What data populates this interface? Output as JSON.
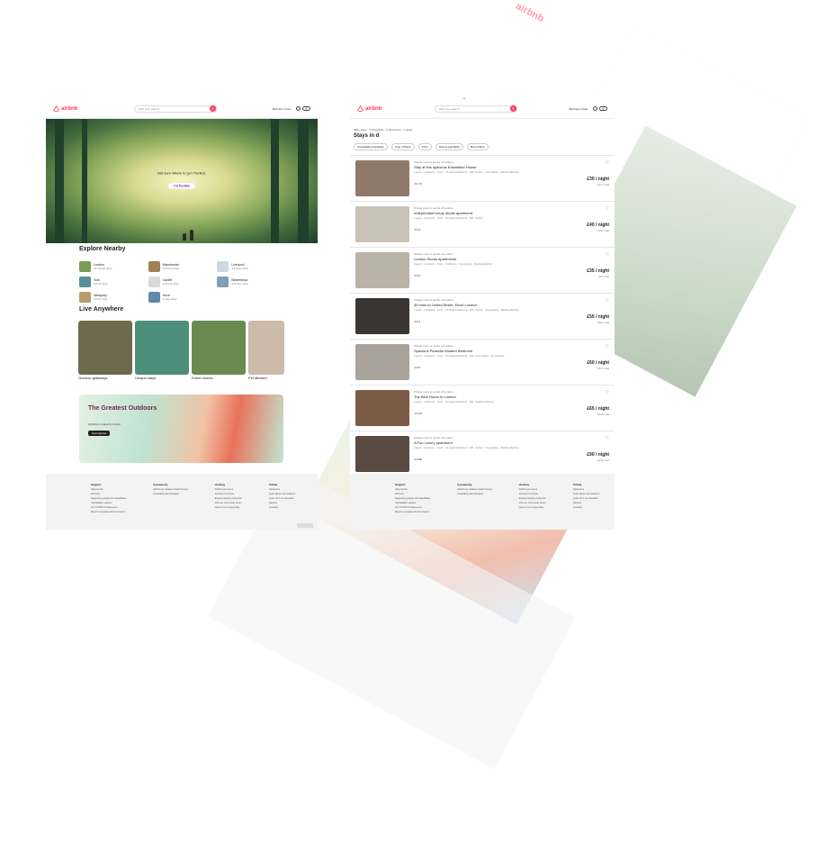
{
  "brand": {
    "name": "airbnb",
    "color": "#ff385c"
  },
  "home": {
    "search_placeholder": "Start your search",
    "host_label": "Become a host",
    "hero_text": "Not sure where to go? Perfect.",
    "hero_button": "I'm flexible",
    "explore_title": "Explore Nearby",
    "nearby": [
      {
        "name": "London",
        "drive": "15 minute drive",
        "color": "#7a9a57"
      },
      {
        "name": "Manchester",
        "drive": "4.5 hour drive",
        "color": "#a18159"
      },
      {
        "name": "Liverpool",
        "drive": "4.5 hour drive",
        "color": "#cfd7e3"
      },
      {
        "name": "York",
        "drive": "4 hour drive",
        "color": "#5b8e9c"
      },
      {
        "name": "Cardiff",
        "drive": "2.5 hour drive",
        "color": "#d9d9d9"
      },
      {
        "name": "Birkenhead",
        "drive": "4.5 hour drive",
        "color": "#7fa0b6"
      },
      {
        "name": "Newquay",
        "drive": "6 hour drive",
        "color": "#b89b6e"
      },
      {
        "name": "Hove",
        "drive": "2 hour drive",
        "color": "#5f8aa8"
      }
    ],
    "live_title": "Live Anywhere",
    "live": [
      {
        "label": "Outdoor getaways",
        "color": "#6f6a4d"
      },
      {
        "label": "Unique stays",
        "color": "#4d8f7b"
      },
      {
        "label": "Entire homes",
        "color": "#6a8a50"
      },
      {
        "label": "Pet allowed",
        "color": "#cbbba8"
      }
    ],
    "promo": {
      "title": "The Greatest Outdoors",
      "subtitle": "Wishlists curated by Airbnb",
      "button": "Get inspired"
    },
    "footer": [
      {
        "heading": "Support",
        "links": [
          "Help Centre",
          "AirCover",
          "Supporting people with disabilities",
          "Cancellation options",
          "Our COVID-19 Response",
          "Report a neighbourhood concern"
        ]
      },
      {
        "heading": "Community",
        "links": [
          "Airbnb.org: disaster relief housing",
          "Combating discrimination"
        ]
      },
      {
        "heading": "Hosting",
        "links": [
          "Airbnb your home",
          "AirCover for Hosts",
          "Explore hosting resources",
          "Visit our community forum",
          "How to host responsibly"
        ]
      },
      {
        "heading": "Airbnb",
        "links": [
          "Newsroom",
          "Learn about new features",
          "Letter from our founders",
          "Careers",
          "Investors"
        ]
      }
    ]
  },
  "listing": {
    "search_placeholder": "Start your search",
    "host_label": "Become a host",
    "breadcrumb": "300+ stays · 5 November - 6 November · 1 guest",
    "title": "Stays in d",
    "filters": [
      "Cancellation Flexibility",
      "Type of Place",
      "Price",
      "Rooms and Beds",
      "More Filters"
    ],
    "rows": [
      {
        "category": "Private room in centre of London",
        "title": "Stay at this spacious Edwardian House",
        "amenities": "1 guest · 1 bedroom · 1 bed · 1.5 shared bathrooms · Wifi · Kitchen · Free parking · Washing Machine",
        "rating": "4.73",
        "price": "£30 / night",
        "total": "£117 total",
        "color": "#8f7a6a"
      },
      {
        "category": "Private room in centre of London",
        "title": "Independant luxury studio apartment",
        "amenities": "2 guest · 1 bedroom · 1 bed · 1.5 shared bathrooms · Wifi · Kitchen",
        "rating": "4.3",
        "price": "£40 / night",
        "total": "£157 total",
        "color": "#c9c2b9"
      },
      {
        "category": "Private room in centre of London",
        "title": "London Studio Apartments",
        "amenities": "4 guest · 1 bedroom · 1 bed · 1 bathroom · Free parking · Washing Machine",
        "rating": "4.6",
        "price": "£35 / night",
        "total": "£27 total",
        "color": "#b9b2a6"
      },
      {
        "category": "Private room in centre of London",
        "title": "30 mins to Oxford Street, Excel London",
        "amenities": "1 guest · 1 bedroom · 1 bed · 1.5 shared bathrooms · Wifi · Kitchen · Free parking · Washing Machine",
        "rating": "4.3",
        "price": "£55 / night",
        "total": "£221 total",
        "color": "#3a3633"
      },
      {
        "category": "Private room in centre of London",
        "title": "Spacious Peaceful Modern Bedroom",
        "amenities": "3 guest · 1 bedroom · 1 bed · 1.5 shared bathrooms · Wifi · Free parking · Dry Cleaning",
        "rating": "4.5",
        "price": "£60 / night",
        "total": "£117 total",
        "color": "#a9a39b"
      },
      {
        "category": "Private room in centre of London",
        "title": "The Blue Room In London",
        "amenities": "2 guest · 1 bedroom · 1 bed · 1.5 shared bathrooms · Wifi · Washing Machine",
        "rating": "4.23",
        "price": "£65 / night",
        "total": "£245 total",
        "color": "#7b5b45"
      },
      {
        "category": "Private room in centre of London",
        "title": "A Fun Luxury apartment",
        "amenities": "2 guest · 1 bedroom · 1 bed · 1.5 shared bathrooms · Wifi · Kitchen · Free parking · Washing Machine",
        "rating": "4.88",
        "price": "£90 / night",
        "total": "£350 total",
        "color": "#5a4b42"
      }
    ],
    "footer": [
      {
        "heading": "Support",
        "links": [
          "Help Centre",
          "AirCover",
          "Supporting people with disabilities",
          "Cancellation options",
          "Our COVID-19 Response",
          "Report a neighbourhood concern"
        ]
      },
      {
        "heading": "Community",
        "links": [
          "Airbnb.org: disaster relief housing",
          "Combating discrimination"
        ]
      },
      {
        "heading": "Hosting",
        "links": [
          "Airbnb your home",
          "AirCover for Hosts",
          "Explore hosting resources",
          "Visit our community forum",
          "How to host responsibly"
        ]
      },
      {
        "heading": "Airbnb",
        "links": [
          "Newsroom",
          "Learn about new features",
          "Letter from our founders",
          "Careers",
          "Investors"
        ]
      }
    ]
  }
}
